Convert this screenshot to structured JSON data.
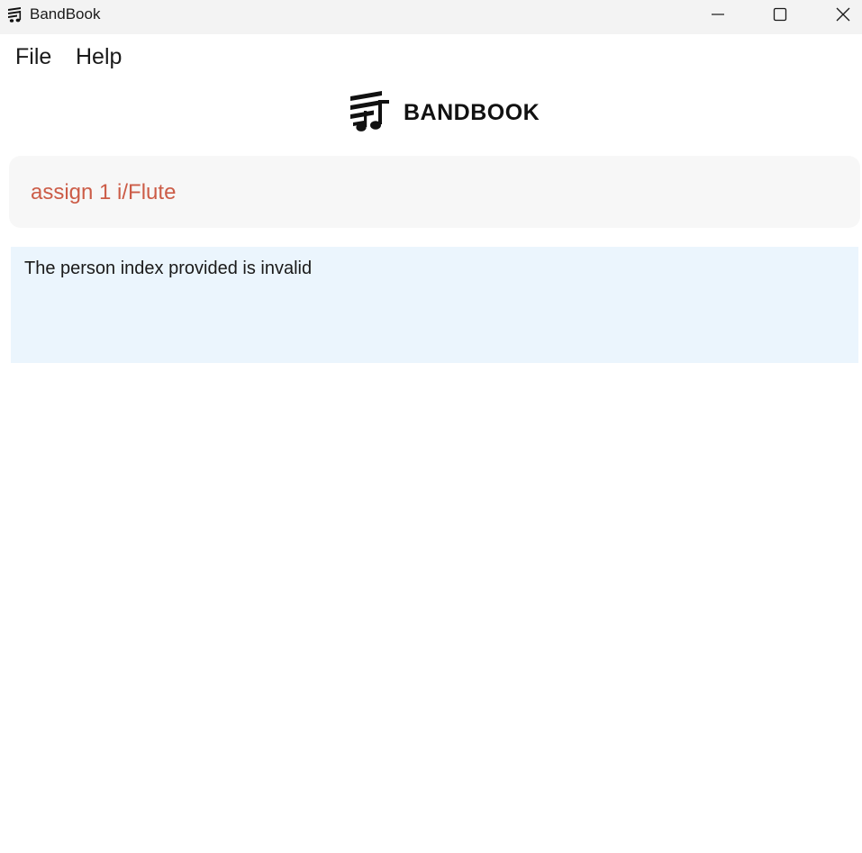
{
  "window": {
    "title": "BandBook",
    "icon": "bandbook-logo-icon",
    "controls": [
      "minimize-icon",
      "maximize-icon",
      "close-icon"
    ]
  },
  "menu": {
    "file": "File",
    "help": "Help"
  },
  "logo": {
    "text": "BANDBOOK",
    "icon": "bandbook-logo-icon"
  },
  "command": {
    "value": "assign 1 i/Flute",
    "error_color": "#cc5c47"
  },
  "result": {
    "message": "The person index provided is invalid"
  },
  "colors": {
    "titlebar": "#f3f3f3",
    "command_box": "#f7f7f7",
    "result_box": "#ebf5fd"
  }
}
